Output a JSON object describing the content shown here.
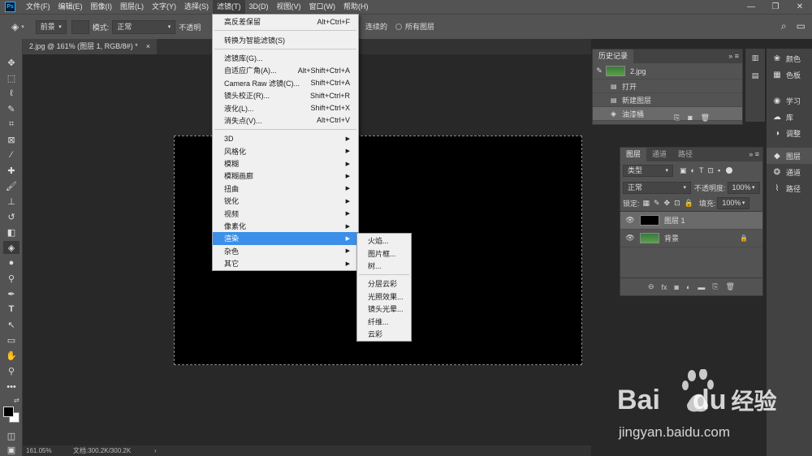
{
  "app": {
    "logo": "Ps"
  },
  "menubar": {
    "items": [
      "文件(F)",
      "编辑(E)",
      "图像(I)",
      "图层(L)",
      "文字(Y)",
      "选择(S)",
      "滤镜(T)",
      "3D(D)",
      "视图(V)",
      "窗口(W)",
      "帮助(H)"
    ],
    "active_index": 6
  },
  "window": {
    "minimize": "—",
    "restore": "❐",
    "close": "✕"
  },
  "options": {
    "foreground": "前景",
    "mode_label": "模式:",
    "mode_value": "正常",
    "opacity_label": "不透明",
    "contiguous": "连续的",
    "all_layers": "所有图层"
  },
  "document": {
    "tab_title": "2.jpg @ 161% (图层 1, RGB/8#) *",
    "close": "×"
  },
  "status": {
    "zoom": "161.05%",
    "doc_info": "文档:300.2K/300.2K",
    "arrow": "›"
  },
  "filter_menu": {
    "items": [
      {
        "label": "高反差保留",
        "shortcut": "Alt+Ctrl+F"
      },
      {
        "sep": true
      },
      {
        "label": "转换为智能滤镜(S)",
        "shortcut": ""
      },
      {
        "sep": true
      },
      {
        "label": "滤镜库(G)...",
        "shortcut": ""
      },
      {
        "label": "自适应广角(A)...",
        "shortcut": "Alt+Shift+Ctrl+A"
      },
      {
        "label": "Camera Raw 滤镜(C)...",
        "shortcut": "Shift+Ctrl+A"
      },
      {
        "label": "镜头校正(R)...",
        "shortcut": "Shift+Ctrl+R"
      },
      {
        "label": "液化(L)...",
        "shortcut": "Shift+Ctrl+X"
      },
      {
        "label": "消失点(V)...",
        "shortcut": "Alt+Ctrl+V"
      },
      {
        "sep": true
      },
      {
        "label": "3D",
        "submenu": true
      },
      {
        "label": "风格化",
        "submenu": true
      },
      {
        "label": "模糊",
        "submenu": true
      },
      {
        "label": "模糊画廊",
        "submenu": true
      },
      {
        "label": "扭曲",
        "submenu": true
      },
      {
        "label": "锐化",
        "submenu": true
      },
      {
        "label": "视频",
        "submenu": true
      },
      {
        "label": "像素化",
        "submenu": true
      },
      {
        "label": "渲染",
        "submenu": true,
        "highlighted": true
      },
      {
        "label": "杂色",
        "submenu": true
      },
      {
        "label": "其它",
        "submenu": true
      }
    ]
  },
  "render_submenu": {
    "items": [
      {
        "label": "火焰..."
      },
      {
        "label": "图片框..."
      },
      {
        "label": "树..."
      },
      {
        "sep": true
      },
      {
        "label": "分层云彩"
      },
      {
        "label": "光照效果..."
      },
      {
        "label": "镜头光晕..."
      },
      {
        "label": "纤维..."
      },
      {
        "label": "云彩"
      }
    ]
  },
  "history": {
    "tab": "历史记录",
    "snapshot": "2.jpg",
    "items": [
      "打开",
      "新建图层",
      "油漆桶"
    ]
  },
  "layers": {
    "tabs": [
      "图层",
      "通道",
      "路径"
    ],
    "filter": "类型",
    "blend": "正常",
    "opacity_label": "不透明度:",
    "opacity": "100%",
    "lock_label": "锁定:",
    "fill_label": "填充:",
    "fill": "100%",
    "items": [
      {
        "name": "图层 1"
      },
      {
        "name": "背景"
      }
    ]
  },
  "dock": {
    "items": [
      "颜色",
      "色板",
      "学习",
      "库",
      "调整",
      "图层",
      "通道",
      "路径"
    ]
  },
  "watermark": {
    "brand": "Bai",
    "brand2": "du",
    "cn": "经验",
    "url": "jingyan.baidu.com"
  },
  "colors": {
    "highlight": "#3c8fe8",
    "panel": "#535353",
    "workspace": "#282828"
  }
}
